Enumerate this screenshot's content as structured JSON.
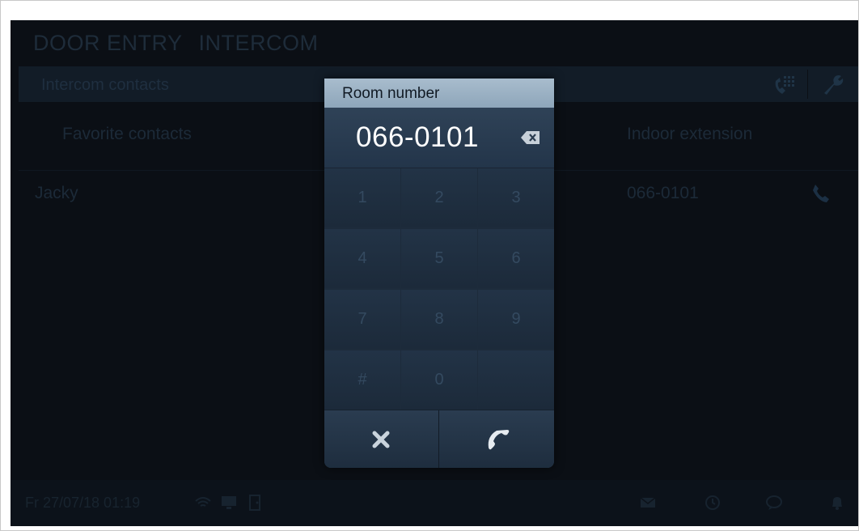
{
  "app": {
    "title_part1": "DOOR ENTRY",
    "title_part2": "INTERCOM"
  },
  "tab": {
    "label": "Intercom contacts"
  },
  "columns": {
    "favorites": "Favorite contacts",
    "extension": "Indoor extension"
  },
  "contacts": [
    {
      "name": "Jacky",
      "room": "066-0101"
    }
  ],
  "status": {
    "datetime": "Fr 27/07/18  01:19"
  },
  "modal": {
    "title": "Room number",
    "value": "066-0101",
    "keys": [
      "1",
      "2",
      "3",
      "4",
      "5",
      "6",
      "7",
      "8",
      "9",
      "#",
      "0",
      ""
    ]
  },
  "colors": {
    "accent": "#8ea6ba",
    "screen": "#0b0f15",
    "modal": "#1d2b3b"
  },
  "icons": [
    "dialpad-icon",
    "wrench-icon",
    "phone-icon",
    "backspace-icon",
    "close-icon",
    "handset-icon",
    "mail-icon",
    "clock-icon",
    "chat-icon",
    "bell-icon",
    "wifi-icon",
    "monitor-icon",
    "door-icon"
  ]
}
